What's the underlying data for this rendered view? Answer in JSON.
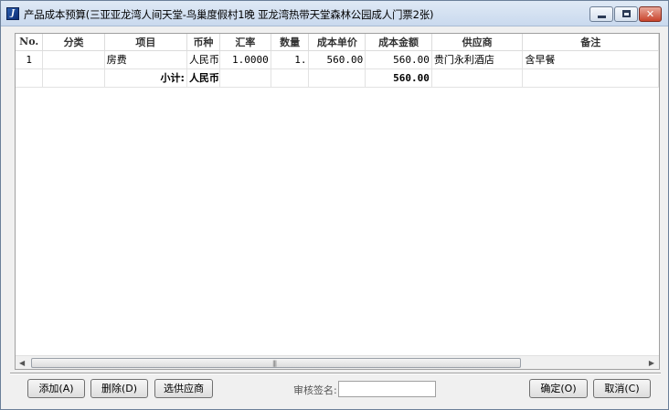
{
  "window": {
    "title": "产品成本预算(三亚亚龙湾人间天堂-鸟巢度假村1晚 亚龙湾热带天堂森林公园成人门票2张)",
    "icon": "app-logo-icon"
  },
  "grid": {
    "columns": [
      "No.",
      "分类",
      "项目",
      "币种",
      "汇率",
      "数量",
      "成本单价",
      "成本金额",
      "供应商",
      "备注"
    ],
    "rows": [
      {
        "no": "1",
        "category": "",
        "item": "房费",
        "currency": "人民币",
        "rate": "1.0000",
        "qty": "1.",
        "unit_cost": "560.00",
        "amount": "560.00",
        "supplier": "贵门永利酒店",
        "note": "含早餐"
      }
    ],
    "subtotal": {
      "label": "小计:",
      "currency": "人民币",
      "amount": "560.00"
    }
  },
  "footer": {
    "add_label": "添加(A)",
    "delete_label": "删除(D)",
    "select_supplier_label": "选供应商",
    "signature_label": "审核签名:",
    "signature_value": "",
    "ok_label": "确定(O)",
    "cancel_label": "取消(C)"
  },
  "colors": {
    "title_bar": "#c9d9ee",
    "close_button": "#c8432b",
    "window_bg": "#f0f0f0"
  }
}
